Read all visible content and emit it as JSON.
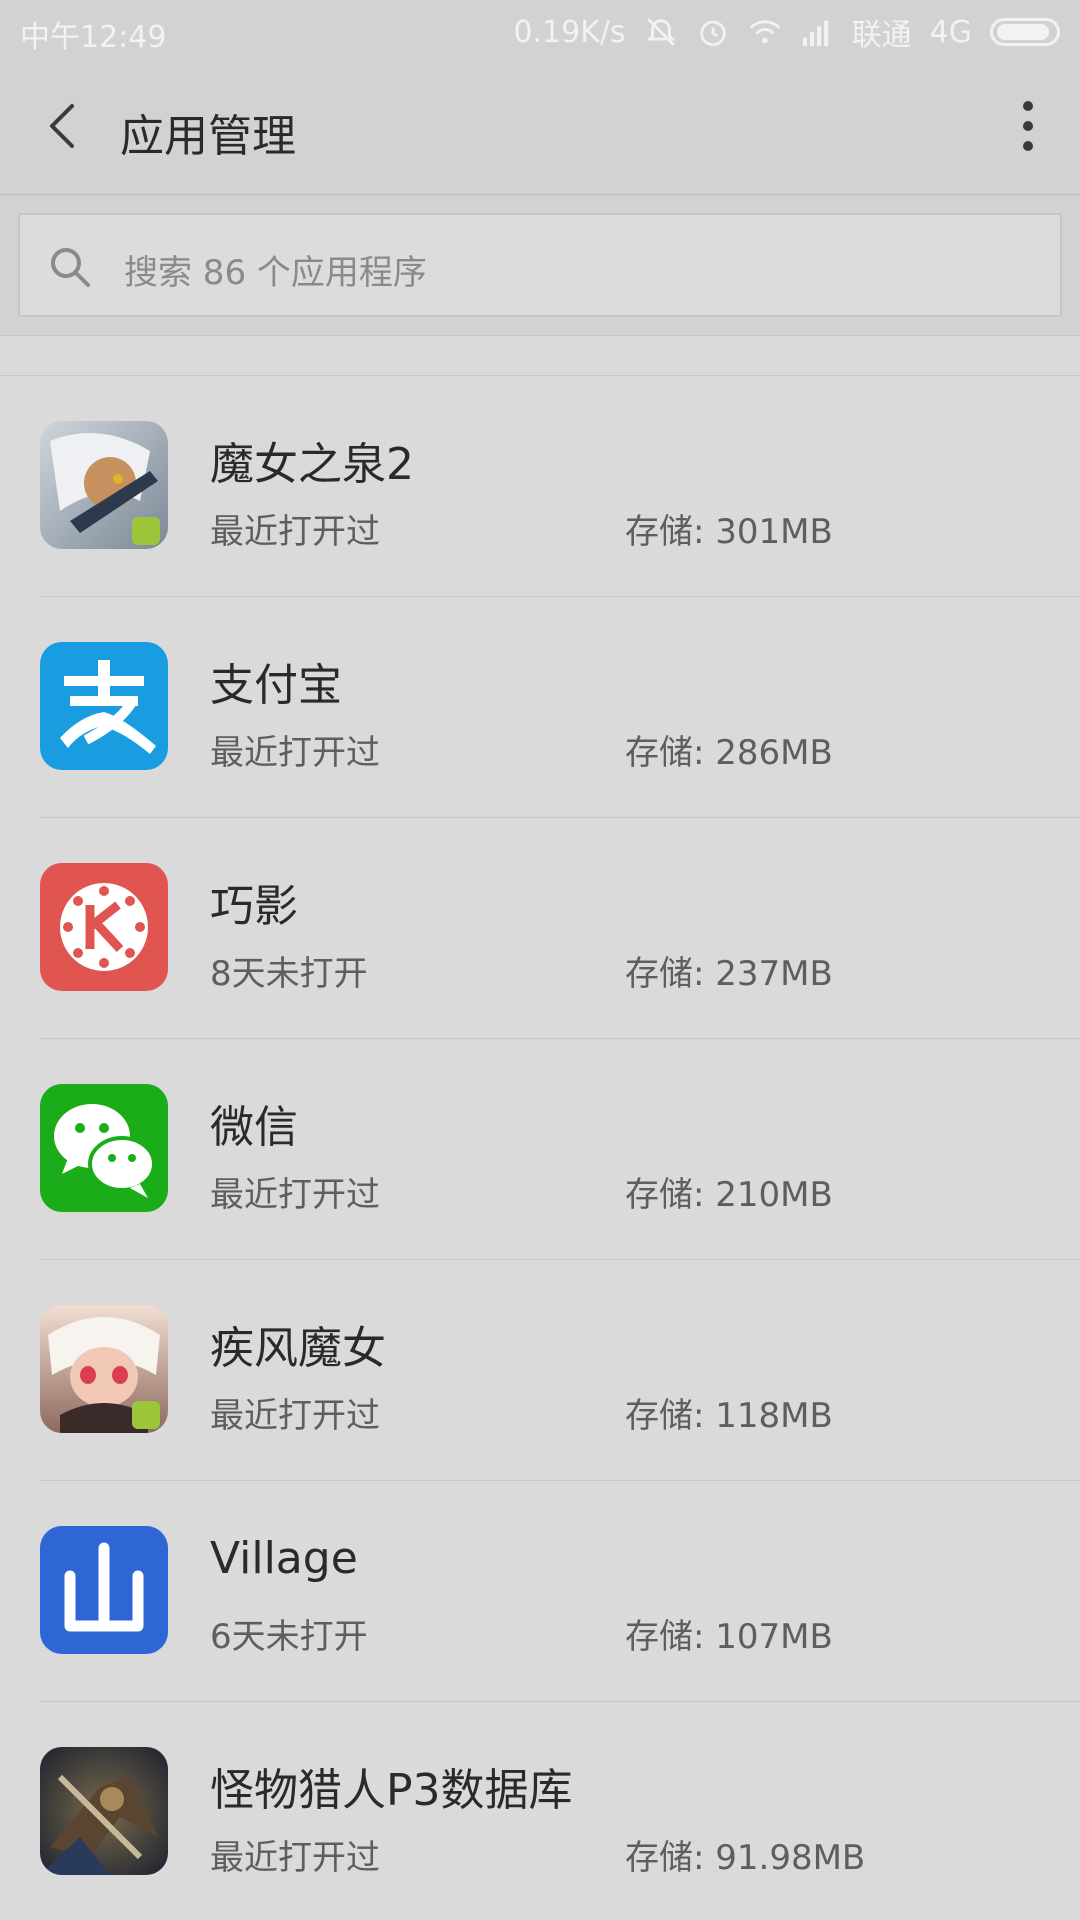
{
  "status_bar": {
    "time": "中午12:49",
    "speed": "0.19K/s",
    "carrier": "联通",
    "network": "4G"
  },
  "header": {
    "title": "应用管理",
    "back_icon": "chevron-left-icon",
    "more_icon": "more-vertical-icon"
  },
  "search": {
    "placeholder": "搜索 86 个应用程序",
    "icon": "search-icon"
  },
  "apps": [
    {
      "name": "魔女之泉2",
      "status": "最近打开过",
      "storage": "存储: 301MB",
      "icon": "anime-girl-icon"
    },
    {
      "name": "支付宝",
      "status": "最近打开过",
      "storage": "存储: 286MB",
      "icon": "alipay-icon",
      "color": "#1a9de0"
    },
    {
      "name": "巧影",
      "status": "8天未打开",
      "storage": "存储: 237MB",
      "icon": "kinemaster-icon",
      "color": "#e05550"
    },
    {
      "name": "微信",
      "status": "最近打开过",
      "storage": "存储: 210MB",
      "icon": "wechat-icon",
      "color": "#1aad19"
    },
    {
      "name": "疾风魔女",
      "status": "最近打开过",
      "storage": "存储: 118MB",
      "icon": "anime-girl-icon"
    },
    {
      "name": "Village",
      "status": "6天未打开",
      "storage": "存储: 107MB",
      "icon": "mountain-char-icon",
      "color": "#2f66d6"
    },
    {
      "name": "怪物猎人P3数据库",
      "status": "最近打开过",
      "storage": "存储: 91.98MB",
      "icon": "monster-hunter-icon"
    }
  ]
}
